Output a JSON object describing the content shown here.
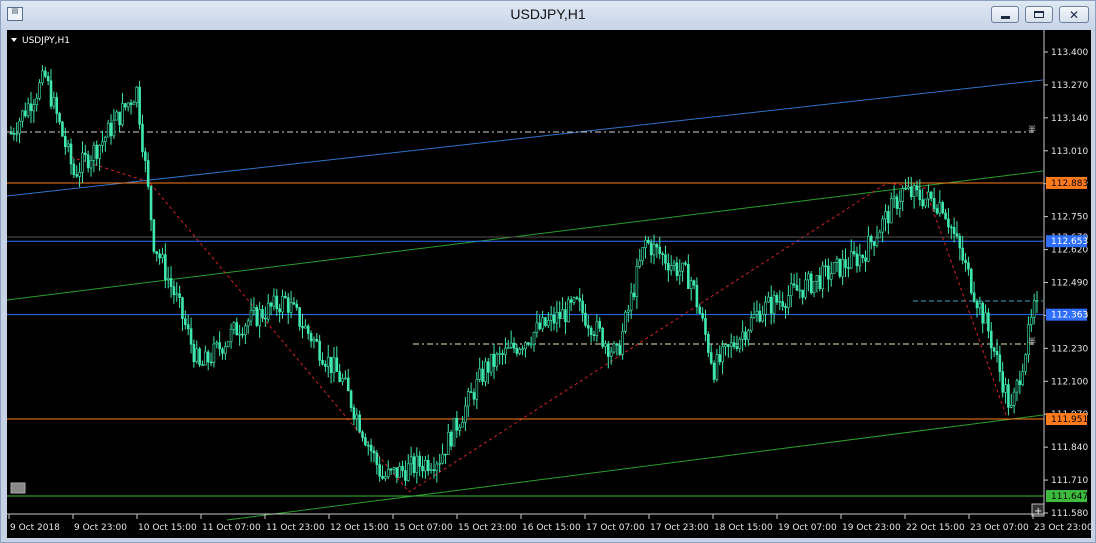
{
  "window": {
    "title": "USDJPY,H1",
    "icon": "chart-window-icon",
    "buttons": {
      "minimize": "minimize-icon",
      "maximize": "restore-icon",
      "close": "close-icon"
    }
  },
  "chart_data": {
    "type": "candlestick",
    "symbol_label": "USDJPY,H1",
    "ylim": [
      111.58,
      113.4
    ],
    "y_ticks": [
      "113.400",
      "113.270",
      "113.140",
      "113.010",
      "112.880",
      "112.750",
      "112.620",
      "112.490",
      "112.360",
      "112.230",
      "112.100",
      "111.970",
      "111.840",
      "111.710",
      "111.580"
    ],
    "x_ticks": [
      "9 Oct 2018",
      "9 Oct 23:00",
      "10 Oct 15:00",
      "11 Oct 07:00",
      "11 Oct 23:00",
      "12 Oct 15:00",
      "15 Oct 07:00",
      "15 Oct 23:00",
      "16 Oct 15:00",
      "17 Oct 07:00",
      "17 Oct 23:00",
      "18 Oct 15:00",
      "19 Oct 07:00",
      "19 Oct 23:00",
      "22 Oct 15:00",
      "23 Oct 07:00",
      "23 Oct 23:00"
    ],
    "horizontal_levels": [
      {
        "value": 112.883,
        "label": "112.883",
        "color": "#ff7a1a"
      },
      {
        "value": 112.653,
        "label": "112.653",
        "color": "#2f6fff"
      },
      {
        "value": 112.363,
        "label": "112.363",
        "color": "#2f6fff"
      },
      {
        "value": 111.951,
        "label": "111.951",
        "color": "#ff7a1a"
      },
      {
        "value": 111.647,
        "label": "111.647",
        "color": "#3dbb3d"
      }
    ],
    "hidden_tick_overlaps": [
      "112.670"
    ],
    "candle_color": "#3fe8b0",
    "anchors": [
      {
        "t": 0,
        "p": 113.08
      },
      {
        "t": 12,
        "p": 113.3
      },
      {
        "t": 22,
        "p": 112.92
      },
      {
        "t": 32,
        "p": 113.05
      },
      {
        "t": 44,
        "p": 113.25
      },
      {
        "t": 50,
        "p": 112.65
      },
      {
        "t": 58,
        "p": 112.42
      },
      {
        "t": 66,
        "p": 112.15
      },
      {
        "t": 80,
        "p": 112.32
      },
      {
        "t": 96,
        "p": 112.42
      },
      {
        "t": 116,
        "p": 112.1
      },
      {
        "t": 130,
        "p": 111.72
      },
      {
        "t": 150,
        "p": 111.8
      },
      {
        "t": 166,
        "p": 112.15
      },
      {
        "t": 184,
        "p": 112.3
      },
      {
        "t": 198,
        "p": 112.4
      },
      {
        "t": 212,
        "p": 112.2
      },
      {
        "t": 222,
        "p": 112.65
      },
      {
        "t": 238,
        "p": 112.5
      },
      {
        "t": 246,
        "p": 112.15
      },
      {
        "t": 262,
        "p": 112.38
      },
      {
        "t": 282,
        "p": 112.5
      },
      {
        "t": 298,
        "p": 112.6
      },
      {
        "t": 312,
        "p": 112.85
      },
      {
        "t": 326,
        "p": 112.8
      },
      {
        "t": 342,
        "p": 112.3
      },
      {
        "t": 350,
        "p": 111.98
      },
      {
        "t": 358,
        "p": 112.38
      }
    ],
    "candle_count": 360
  }
}
